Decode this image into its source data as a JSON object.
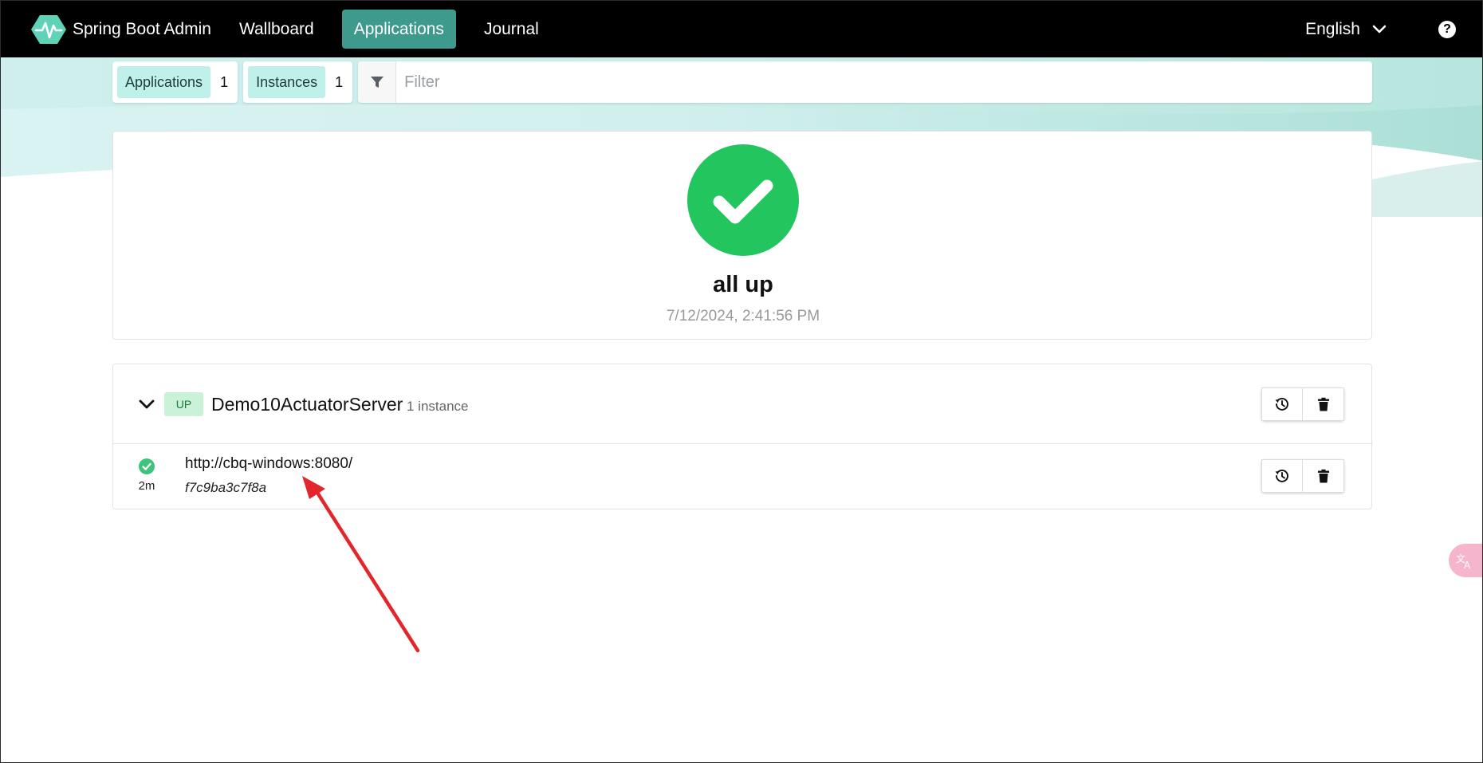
{
  "navbar": {
    "brand": "Spring Boot Admin",
    "items": [
      {
        "label": "Wallboard",
        "active": false
      },
      {
        "label": "Applications",
        "active": true
      },
      {
        "label": "Journal",
        "active": false
      }
    ],
    "language": "English",
    "help_label": "?"
  },
  "filter": {
    "applications_label": "Applications",
    "applications_count": "1",
    "instances_label": "Instances",
    "instances_count": "1",
    "placeholder": "Filter"
  },
  "status": {
    "text": "all up",
    "timestamp": "7/12/2024, 2:41:56 PM"
  },
  "application": {
    "status_badge": "UP",
    "name": "Demo10ActuatorServer",
    "instance_count_label": "1 instance",
    "instances": [
      {
        "url": "http://cbq-windows:8080/",
        "id": "f7c9ba3c7f8a",
        "age": "2m"
      }
    ]
  },
  "colors": {
    "accent": "#3d9a8c",
    "status_up": "#23c55e",
    "chip_bg": "#bff0ea",
    "annotation": "#e3262b"
  }
}
